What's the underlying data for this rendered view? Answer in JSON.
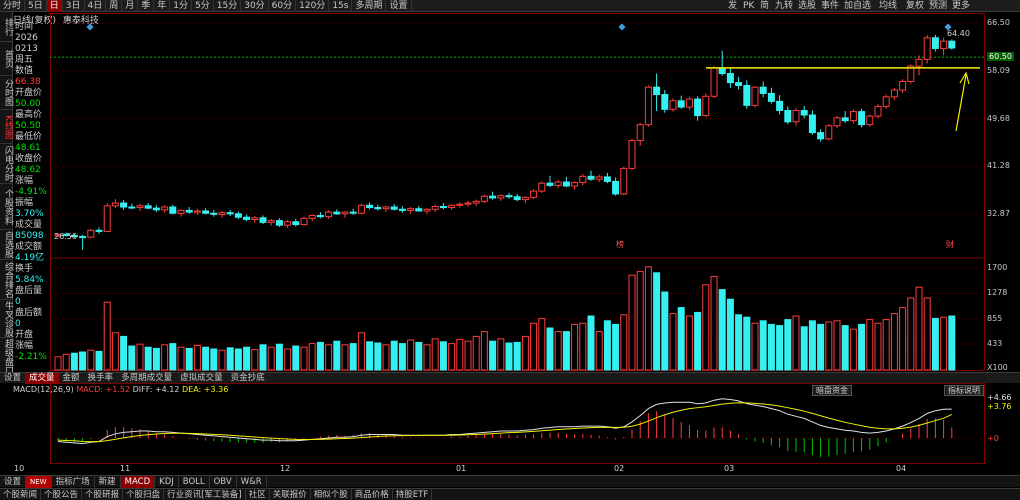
{
  "toolbar": {
    "left": [
      "分时",
      "5日",
      "日",
      "3日",
      "4日",
      "周",
      "月",
      "季",
      "年",
      "1分",
      "5分",
      "15分",
      "30分",
      "60分",
      "120分",
      "15s",
      "多周期",
      "设置"
    ],
    "active_index": 2,
    "right": [
      "发",
      "PK",
      "简",
      "九转",
      "选股",
      "事件",
      "加自选",
      "均线",
      "复权",
      "预测",
      "更多"
    ]
  },
  "stock": {
    "title": "日线(复权)",
    "name": "惠泰科技"
  },
  "sidebar": [
    "排行",
    "首页",
    "分时图",
    "K线图",
    "闪电分时",
    "个股资料",
    "自选股",
    "综合排名",
    "牛叉诊股",
    "超级盘口"
  ],
  "sidebar_active": 3,
  "info": [
    {
      "text": "时间",
      "color": "white"
    },
    {
      "text": "2026",
      "color": "white"
    },
    {
      "text": "0213",
      "color": "white"
    },
    {
      "text": "周五",
      "color": "white"
    },
    {
      "text": "数值",
      "color": "white"
    },
    {
      "text": "66.38",
      "color": "red"
    },
    {
      "text": "开盘价",
      "color": "white"
    },
    {
      "text": "50.00",
      "color": "grn"
    },
    {
      "text": "最高价",
      "color": "white"
    },
    {
      "text": "50.50",
      "color": "grn"
    },
    {
      "text": "最低价",
      "color": "white"
    },
    {
      "text": "48.61",
      "color": "grn"
    },
    {
      "text": "收盘价",
      "color": "white"
    },
    {
      "text": "48.62",
      "color": "grn"
    },
    {
      "text": "涨幅",
      "color": "white"
    },
    {
      "text": "-4.91%",
      "color": "grn"
    },
    {
      "text": "振幅",
      "color": "white"
    },
    {
      "text": "3.70%",
      "color": "cyan"
    },
    {
      "text": "成交量",
      "color": "white"
    },
    {
      "text": "85098",
      "color": "cyan"
    },
    {
      "text": "成交额",
      "color": "white"
    },
    {
      "text": "4.19亿",
      "color": "cyan"
    },
    {
      "text": "换手",
      "color": "white"
    },
    {
      "text": "5.84%",
      "color": "cyan"
    },
    {
      "text": "盘后量",
      "color": "white"
    },
    {
      "text": "0",
      "color": "cyan"
    },
    {
      "text": "盘后额",
      "color": "white"
    },
    {
      "text": "0",
      "color": "cyan"
    },
    {
      "text": "开盘",
      "color": "white"
    },
    {
      "text": "涨幅",
      "color": "white"
    },
    {
      "text": "-2.21%",
      "color": "grn"
    }
  ],
  "price_axis": [
    "66.50",
    "60.50",
    "58.09",
    "49.68",
    "41.28",
    "32.87"
  ],
  "price_tag": "60.50",
  "volume_axis": [
    "1700",
    "1278",
    "855",
    "433",
    "X100"
  ],
  "macd_axis": [
    "+4.66",
    "+3.76",
    "+0"
  ],
  "annotations": {
    "high": "64.40",
    "low": "26.56",
    "tag1": "榜",
    "tag2": "财"
  },
  "indicator_bar": [
    "设置",
    "成交量",
    "金额",
    "换手率",
    "多周期成交量",
    "虚拟成交量",
    "资金抄底"
  ],
  "indicator_active": 1,
  "macd_label": {
    "name": "MACD(12,26,9)",
    "macd": "MACD: +1.52",
    "diff": "DIFF: +4.12",
    "dea": "DEA: +3.36"
  },
  "macd_buttons": {
    "left": "暗盘资金",
    "right": "指标说明"
  },
  "date_axis": [
    "10",
    "11",
    "12",
    "01",
    "02",
    "03",
    "04"
  ],
  "tabs1": [
    "设置",
    "NEW",
    "指标广场",
    "新建",
    "MACD",
    "KDJ",
    "BOLL",
    "OBV",
    "W&R"
  ],
  "tabs1_active": 4,
  "tabs2": [
    "个股新闻",
    "个股公告",
    "个股研报",
    "个股扫盘",
    "行业资讯[军工装备]",
    "社区",
    "关联报价",
    "相似个股",
    "商品价格",
    "持股ETF"
  ],
  "colors": {
    "up": "#ff3c3c",
    "down": "#35f0f0",
    "accent": "#8a0000",
    "yellow": "#f0f000"
  },
  "chart_data": {
    "type": "candlestick",
    "candles": [
      [
        29.0,
        29.5,
        28.8,
        29.3
      ],
      [
        29.3,
        29.6,
        28.9,
        29.1
      ],
      [
        29.1,
        29.4,
        28.7,
        28.9
      ],
      [
        28.9,
        29.2,
        26.56,
        28.8
      ],
      [
        28.8,
        30.2,
        28.6,
        30.0
      ],
      [
        30.0,
        30.5,
        29.4,
        29.8
      ],
      [
        29.8,
        34.8,
        29.7,
        34.3
      ],
      [
        34.3,
        35.5,
        33.9,
        34.8
      ],
      [
        34.8,
        35.3,
        33.6,
        34.1
      ],
      [
        34.1,
        34.7,
        33.7,
        34.0
      ],
      [
        34.0,
        34.6,
        33.4,
        34.3
      ],
      [
        34.3,
        34.8,
        33.7,
        33.9
      ],
      [
        33.9,
        34.4,
        33.2,
        33.6
      ],
      [
        33.6,
        34.4,
        33.1,
        34.1
      ],
      [
        34.1,
        34.5,
        32.8,
        33.0
      ],
      [
        33.0,
        33.7,
        32.4,
        33.5
      ],
      [
        33.5,
        34.1,
        32.9,
        33.2
      ],
      [
        33.2,
        33.8,
        32.7,
        33.4
      ],
      [
        33.4,
        33.9,
        32.8,
        33.0
      ],
      [
        33.0,
        33.6,
        32.4,
        32.8
      ],
      [
        32.8,
        33.4,
        32.2,
        33.1
      ],
      [
        33.1,
        33.6,
        32.5,
        32.9
      ],
      [
        32.9,
        33.3,
        32.0,
        32.3
      ],
      [
        32.3,
        32.8,
        31.6,
        31.9
      ],
      [
        31.9,
        32.5,
        31.3,
        32.2
      ],
      [
        32.2,
        32.6,
        31.1,
        31.4
      ],
      [
        31.4,
        32.0,
        30.8,
        31.7
      ],
      [
        31.7,
        32.1,
        30.6,
        30.9
      ],
      [
        30.9,
        31.8,
        30.4,
        31.5
      ],
      [
        31.5,
        32.0,
        30.7,
        31.0
      ],
      [
        31.0,
        32.4,
        30.8,
        32.1
      ],
      [
        32.1,
        32.8,
        31.6,
        32.6
      ],
      [
        32.6,
        33.2,
        32.1,
        32.4
      ],
      [
        32.4,
        33.5,
        32.0,
        33.2
      ],
      [
        33.2,
        33.7,
        32.7,
        32.9
      ],
      [
        32.9,
        33.4,
        32.2,
        33.2
      ],
      [
        33.2,
        33.8,
        32.7,
        33.0
      ],
      [
        33.0,
        34.7,
        32.8,
        34.4
      ],
      [
        34.4,
        34.9,
        33.7,
        34.0
      ],
      [
        34.0,
        34.5,
        33.5,
        33.8
      ],
      [
        33.8,
        34.3,
        33.2,
        34.1
      ],
      [
        34.1,
        34.6,
        33.5,
        33.7
      ],
      [
        33.7,
        34.2,
        33.1,
        33.5
      ],
      [
        33.5,
        34.1,
        32.9,
        33.8
      ],
      [
        33.8,
        34.3,
        33.3,
        33.4
      ],
      [
        33.4,
        33.9,
        32.8,
        33.7
      ],
      [
        33.7,
        34.5,
        33.2,
        34.2
      ],
      [
        34.2,
        34.8,
        33.7,
        34.0
      ],
      [
        34.0,
        34.6,
        33.6,
        34.4
      ],
      [
        34.4,
        34.9,
        34.0,
        34.6
      ],
      [
        34.6,
        35.2,
        34.2,
        34.8
      ],
      [
        34.8,
        35.4,
        34.3,
        35.1
      ],
      [
        35.1,
        36.3,
        34.8,
        36.0
      ],
      [
        36.0,
        36.8,
        35.4,
        35.7
      ],
      [
        35.7,
        36.3,
        35.2,
        36.1
      ],
      [
        36.1,
        36.6,
        35.6,
        35.9
      ],
      [
        35.9,
        36.4,
        35.1,
        35.4
      ],
      [
        35.4,
        36.0,
        34.8,
        35.8
      ],
      [
        35.8,
        37.2,
        35.5,
        36.9
      ],
      [
        36.9,
        38.6,
        36.6,
        38.3
      ],
      [
        38.3,
        39.6,
        37.6,
        37.9
      ],
      [
        37.9,
        38.9,
        37.4,
        38.5
      ],
      [
        38.5,
        39.4,
        37.6,
        37.8
      ],
      [
        37.8,
        38.6,
        37.2,
        38.4
      ],
      [
        38.4,
        39.9,
        37.9,
        39.5
      ],
      [
        39.5,
        40.5,
        38.7,
        39.0
      ],
      [
        39.0,
        39.8,
        38.5,
        39.4
      ],
      [
        39.4,
        40.1,
        38.3,
        38.6
      ],
      [
        38.6,
        39.3,
        36.1,
        36.4
      ],
      [
        36.4,
        41.2,
        36.2,
        40.9
      ],
      [
        40.9,
        46.1,
        40.6,
        45.8
      ],
      [
        45.8,
        48.9,
        44.9,
        48.6
      ],
      [
        48.6,
        55.5,
        48.2,
        55.2
      ],
      [
        55.2,
        57.6,
        51.0,
        53.9
      ],
      [
        53.9,
        54.7,
        50.7,
        51.3
      ],
      [
        51.3,
        53.2,
        50.9,
        52.8
      ],
      [
        52.8,
        53.7,
        51.4,
        51.7
      ],
      [
        51.7,
        53.5,
        51.2,
        53.1
      ],
      [
        53.1,
        53.6,
        49.3,
        50.2
      ],
      [
        50.2,
        54.1,
        49.9,
        53.6
      ],
      [
        53.6,
        58.9,
        53.3,
        58.6
      ],
      [
        58.6,
        61.6,
        57.2,
        57.6
      ],
      [
        57.6,
        58.7,
        55.1,
        56.0
      ],
      [
        56.0,
        57.0,
        54.8,
        55.5
      ],
      [
        55.5,
        56.4,
        51.4,
        52.0
      ],
      [
        52.0,
        55.4,
        51.6,
        55.2
      ],
      [
        55.2,
        56.2,
        53.4,
        54.1
      ],
      [
        54.1,
        55.1,
        52.3,
        52.7
      ],
      [
        52.7,
        53.8,
        50.4,
        51.1
      ],
      [
        51.1,
        51.8,
        48.7,
        49.1
      ],
      [
        49.1,
        51.5,
        48.4,
        51.1
      ],
      [
        51.1,
        51.9,
        49.7,
        50.3
      ],
      [
        50.3,
        51.1,
        46.8,
        47.2
      ],
      [
        47.2,
        47.8,
        45.6,
        46.1
      ],
      [
        46.1,
        48.7,
        45.8,
        48.4
      ],
      [
        48.4,
        50.2,
        48.0,
        49.8
      ],
      [
        49.8,
        51.0,
        48.9,
        49.3
      ],
      [
        49.3,
        51.3,
        48.8,
        50.9
      ],
      [
        50.9,
        51.4,
        48.1,
        48.6
      ],
      [
        48.6,
        50.4,
        48.2,
        50.1
      ],
      [
        50.1,
        52.2,
        49.7,
        51.8
      ],
      [
        51.8,
        53.9,
        51.4,
        53.5
      ],
      [
        53.5,
        55.1,
        52.9,
        54.7
      ],
      [
        54.7,
        56.6,
        54.2,
        56.2
      ],
      [
        56.2,
        59.2,
        55.8,
        58.9
      ],
      [
        58.9,
        60.8,
        57.3,
        60.1
      ],
      [
        60.1,
        64.4,
        59.4,
        63.9
      ],
      [
        63.9,
        64.4,
        61.5,
        62.0
      ],
      [
        62.0,
        63.9,
        60.8,
        63.3
      ],
      [
        63.3,
        63.6,
        61.8,
        62.1
      ]
    ],
    "volumes": [
      220,
      260,
      280,
      300,
      330,
      310,
      1130,
      620,
      560,
      400,
      430,
      380,
      360,
      420,
      440,
      380,
      360,
      410,
      380,
      350,
      330,
      370,
      350,
      380,
      340,
      420,
      380,
      430,
      350,
      400,
      380,
      440,
      460,
      420,
      480,
      420,
      440,
      620,
      470,
      450,
      420,
      480,
      440,
      500,
      460,
      420,
      520,
      470,
      440,
      510,
      480,
      560,
      640,
      480,
      520,
      450,
      460,
      560,
      780,
      860,
      700,
      640,
      640,
      760,
      780,
      900,
      640,
      820,
      760,
      920,
      1580,
      1640,
      1720,
      1620,
      1300,
      940,
      1040,
      900,
      960,
      1420,
      1560,
      1340,
      1180,
      920,
      880,
      780,
      820,
      760,
      740,
      840,
      900,
      720,
      820,
      760,
      800,
      820,
      740,
      680,
      760,
      840,
      780,
      840,
      940,
      1040,
      1200,
      1380,
      1200,
      860,
      880,
      900
    ],
    "volume_up": [
      true,
      true,
      false,
      false,
      true,
      false,
      true,
      true,
      false,
      false,
      true,
      false,
      false,
      true,
      false,
      true,
      false,
      true,
      false,
      false,
      true,
      false,
      false,
      false,
      true,
      false,
      true,
      false,
      true,
      false,
      true,
      true,
      false,
      true,
      false,
      true,
      false,
      true,
      false,
      false,
      true,
      false,
      false,
      true,
      false,
      true,
      true,
      false,
      true,
      true,
      true,
      true,
      true,
      false,
      true,
      false,
      false,
      true,
      true,
      true,
      false,
      true,
      false,
      true,
      true,
      false,
      true,
      false,
      false,
      true,
      true,
      true,
      true,
      false,
      false,
      true,
      false,
      true,
      false,
      true,
      true,
      false,
      false,
      false,
      false,
      true,
      false,
      false,
      false,
      false,
      true,
      false,
      false,
      false,
      true,
      true,
      false,
      true,
      false,
      true,
      true,
      true,
      true,
      true,
      true,
      true,
      true,
      false,
      true,
      false
    ],
    "macd_diff": [
      -0.5,
      -0.6,
      -0.7,
      -0.8,
      -0.6,
      -0.5,
      0.2,
      0.6,
      0.8,
      0.9,
      1.0,
      1.0,
      0.9,
      0.9,
      0.8,
      0.7,
      0.6,
      0.5,
      0.4,
      0.3,
      0.2,
      0.1,
      0.0,
      -0.1,
      -0.2,
      -0.3,
      -0.3,
      -0.4,
      -0.4,
      -0.4,
      -0.3,
      -0.2,
      -0.1,
      0.0,
      0.1,
      0.1,
      0.2,
      0.4,
      0.5,
      0.5,
      0.5,
      0.5,
      0.4,
      0.4,
      0.4,
      0.4,
      0.4,
      0.4,
      0.5,
      0.5,
      0.6,
      0.7,
      0.8,
      0.9,
      1.0,
      1.0,
      1.0,
      1.1,
      1.2,
      1.4,
      1.5,
      1.6,
      1.6,
      1.6,
      1.7,
      1.7,
      1.7,
      1.6,
      1.4,
      1.6,
      2.3,
      3.2,
      4.2,
      4.8,
      5.0,
      5.1,
      5.1,
      5.1,
      4.9,
      5.0,
      5.4,
      5.6,
      5.5,
      5.3,
      4.9,
      4.7,
      4.5,
      4.2,
      3.9,
      3.4,
      3.1,
      2.8,
      2.3,
      1.8,
      1.5,
      1.3,
      1.1,
      1.0,
      0.8,
      0.7,
      0.8,
      1.0,
      1.3,
      1.7,
      2.2,
      2.8,
      3.5,
      3.9,
      4.1,
      4.12
    ],
    "macd_dea": [
      -0.3,
      -0.35,
      -0.4,
      -0.5,
      -0.52,
      -0.52,
      -0.37,
      -0.18,
      0.02,
      0.2,
      0.36,
      0.49,
      0.57,
      0.64,
      0.67,
      0.68,
      0.66,
      0.63,
      0.58,
      0.52,
      0.46,
      0.39,
      0.31,
      0.23,
      0.14,
      0.05,
      -0.02,
      -0.09,
      -0.15,
      -0.2,
      -0.22,
      -0.22,
      -0.2,
      -0.16,
      -0.11,
      -0.07,
      -0.02,
      0.06,
      0.15,
      0.22,
      0.28,
      0.32,
      0.34,
      0.35,
      0.36,
      0.37,
      0.38,
      0.38,
      0.4,
      0.42,
      0.46,
      0.5,
      0.56,
      0.63,
      0.7,
      0.76,
      0.81,
      0.87,
      0.94,
      1.03,
      1.12,
      1.22,
      1.29,
      1.36,
      1.42,
      1.48,
      1.52,
      1.54,
      1.51,
      1.53,
      1.68,
      1.98,
      2.42,
      2.9,
      3.32,
      3.68,
      3.96,
      4.19,
      4.33,
      4.46,
      4.65,
      4.84,
      4.97,
      5.04,
      5.01,
      4.95,
      4.86,
      4.73,
      4.56,
      4.33,
      4.09,
      3.83,
      3.52,
      3.18,
      2.84,
      2.53,
      2.24,
      1.99,
      1.75,
      1.54,
      1.39,
      1.31,
      1.31,
      1.39,
      1.55,
      1.8,
      2.14,
      2.49,
      2.81,
      3.36
    ],
    "ylim": [
      26.0,
      66.5
    ]
  }
}
